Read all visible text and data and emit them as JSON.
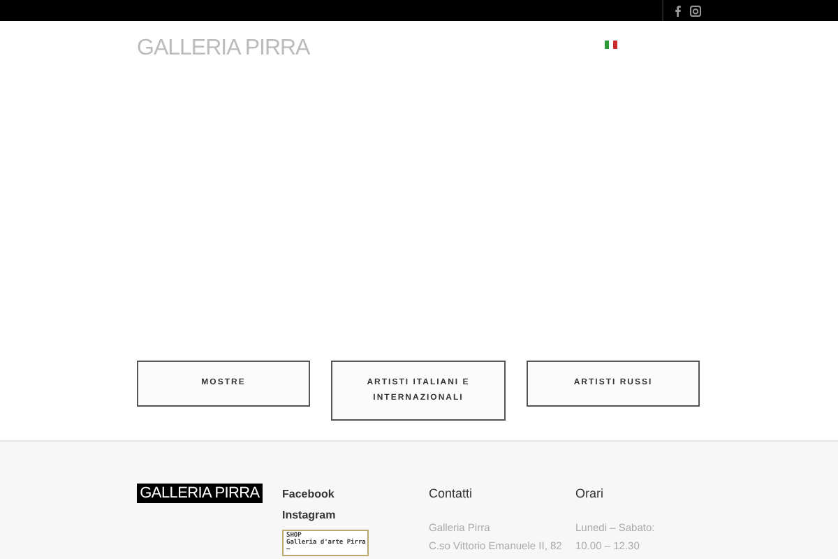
{
  "header": {
    "logo": "GALLERIA PIRRA"
  },
  "categories": [
    {
      "label": "MOSTRE"
    },
    {
      "label": "ARTISTI ITALIANI E INTERNAZIONALI"
    },
    {
      "label": "ARTISTI RUSSI"
    }
  ],
  "footer": {
    "logo": "GALLERIA PIRRA",
    "social_links": [
      "Facebook",
      "Instagram"
    ],
    "shop_badge": {
      "title": "SHOP",
      "subtitle": "Galleria d'arte Pirra",
      "dash": "—"
    },
    "columns": [
      {
        "heading": "Contatti",
        "lines": [
          "Galleria Pirra",
          "C.so Vittorio Emanuele II, 82"
        ]
      },
      {
        "heading": "Orari",
        "lines": [
          "Lunedi – Sabato:",
          "10.00 – 12.30"
        ]
      }
    ]
  }
}
